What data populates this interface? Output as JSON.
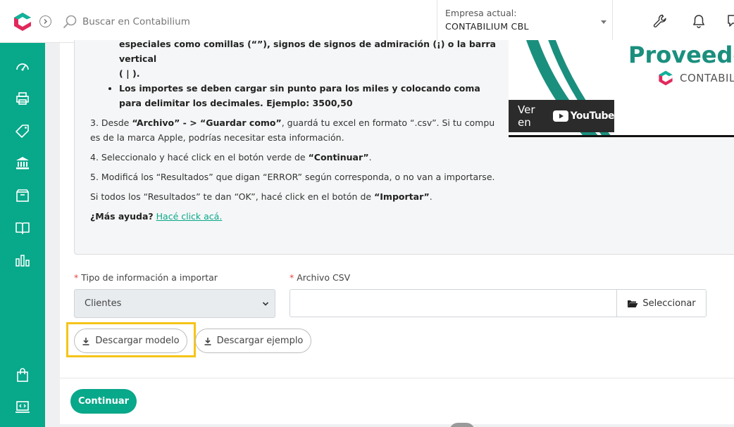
{
  "header": {
    "search_placeholder": "Buscar en Contabilium",
    "company_label": "Empresa actual:",
    "company_value": "CONTABILIUM CBL"
  },
  "sidebar": {
    "items": [
      "dashboard-icon",
      "printer-icon",
      "tag-icon",
      "bank-icon",
      "box-icon",
      "book-icon",
      "chart-icon",
      "bag-icon",
      "code-icon"
    ]
  },
  "instructions": {
    "partial_line_1": "especiales como comillas (“”), signos de signos de admiración (¡) o la barra vertical",
    "partial_line_2": "( | ).",
    "bullet_amounts": "Los importes se deben cargar sin punto para los miles y colocando coma para delimitar los decimales. Ejemplo: 3500,50",
    "step3_prefix": "3. Desde ",
    "step3_archivo": "“Archivo” - > “Guardar como”",
    "step3_suffix": ", guardá tu excel en formato “.csv”. Si tu compu es de la marca Apple, podrías necesitar esta información.",
    "step4_prefix": "4. Seleccionalo y hacé click en el botón verde de ",
    "step4_bold": "“Continuar”",
    "step4_suffix": ".",
    "step5": "5. Modificá los “Resultados” que digan “ERROR” según corresponda, o no van a importarse.",
    "final_prefix": "Si todos los “Resultados” te dan “OK”, hacé click en el botón de ",
    "final_bold": "“Importar”",
    "final_suffix": ".",
    "help_question": "¿Más ayuda?",
    "help_link": "Hacé click acá."
  },
  "video": {
    "title_partial": "Proveedo",
    "brand": "CONTABILI",
    "watch_on": "Ver en",
    "youtube": "YouTube"
  },
  "form": {
    "type_label": "Tipo de información a importar",
    "type_value": "Clientes",
    "csv_label": "Archivo CSV",
    "select_button": "Seleccionar",
    "download_model": "Descargar modelo",
    "download_example": "Descargar ejemplo",
    "continue": "Continuar"
  },
  "colors": {
    "brand_green": "#08a88a",
    "highlight": "#f5c518",
    "required": "#e0473f"
  }
}
